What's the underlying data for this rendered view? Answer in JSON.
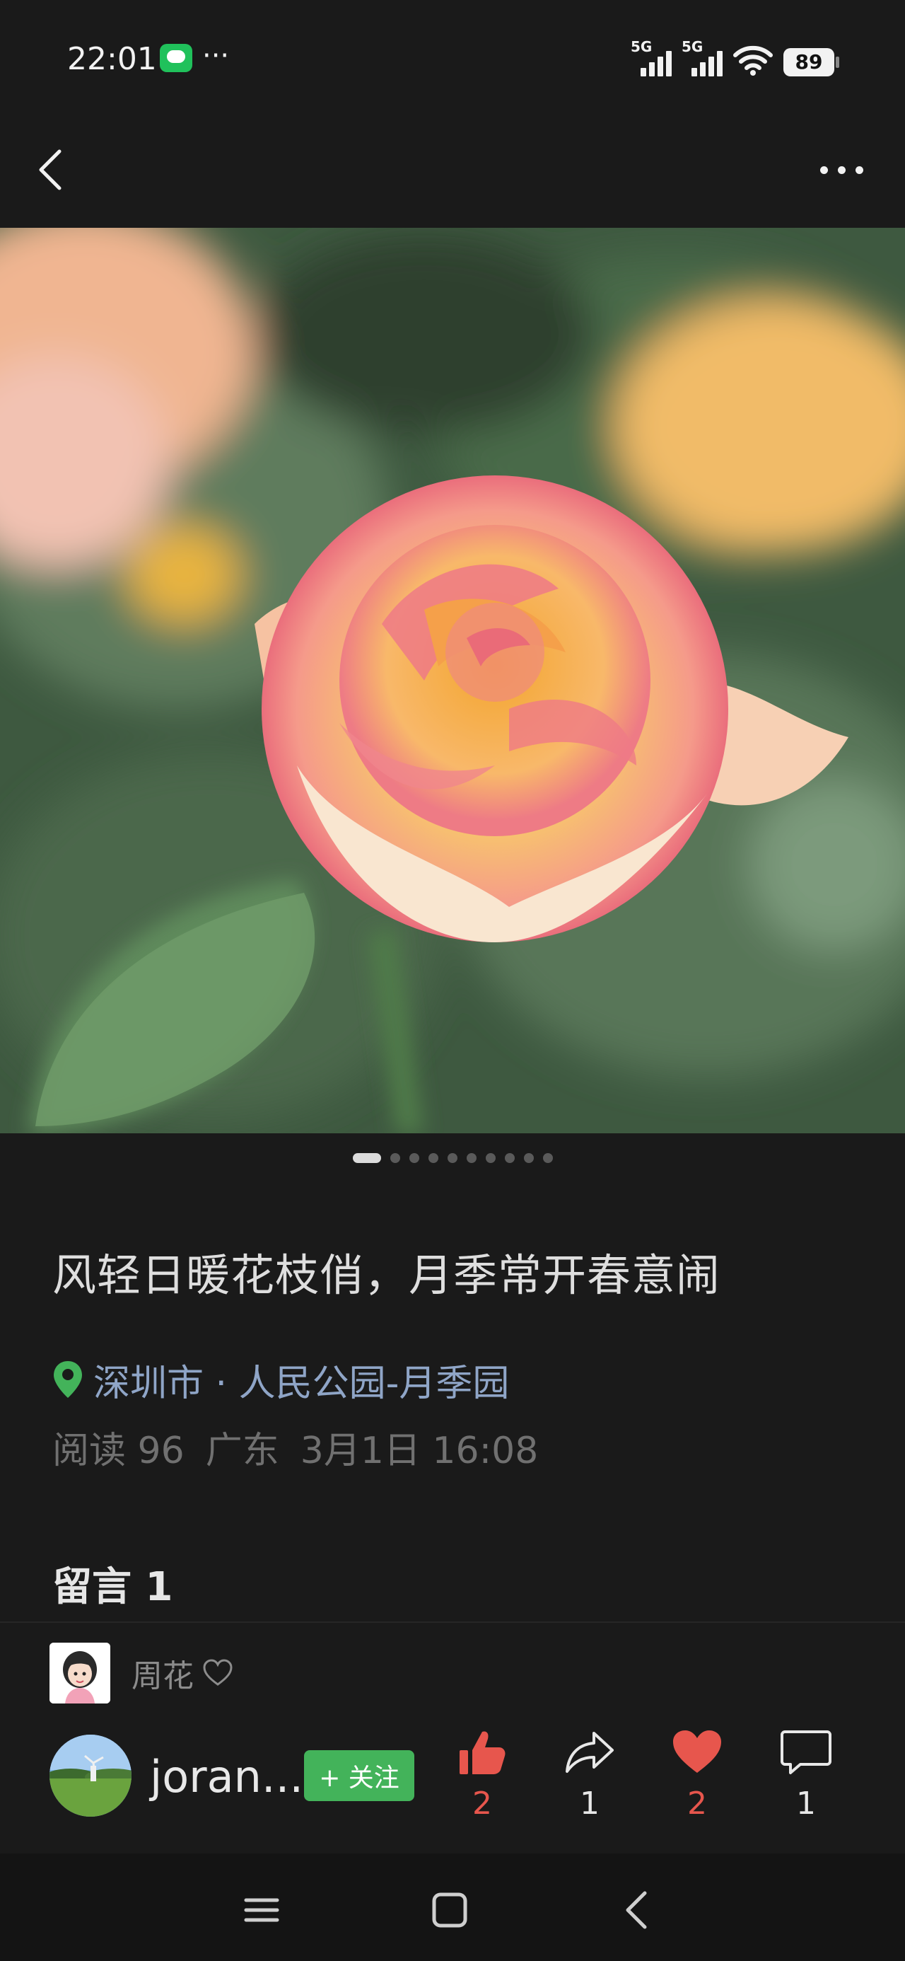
{
  "status_bar": {
    "time": "22:01",
    "more": "···",
    "signal_1_label": "5G",
    "signal_2_label": "5G",
    "battery": "89",
    "icons": [
      "message-icon",
      "signal-icon",
      "wifi-icon",
      "battery-icon"
    ]
  },
  "nav": {
    "back_icon": "chevron-left-icon",
    "more_icon": "more-horizontal-icon"
  },
  "gallery": {
    "photo_count": 10,
    "active_index": 0
  },
  "post": {
    "title": "风轻日暖花枝俏，月季常开春意闹",
    "location": "深圳市 · 人民公园-月季园",
    "read_label": "阅读",
    "read_count": "96",
    "region": "广东",
    "datetime": "3月1日 16:08"
  },
  "comments": {
    "heading": "留言 1",
    "items": [
      {
        "name": "周花",
        "icon": "heart-outline-icon"
      }
    ]
  },
  "author": {
    "name": "joran...",
    "follow_label": "+ 关注"
  },
  "actions": {
    "like": {
      "count": "2",
      "icon": "thumbs-up-icon"
    },
    "share": {
      "count": "1",
      "icon": "share-icon"
    },
    "favorite": {
      "count": "2",
      "icon": "heart-icon"
    },
    "comment": {
      "count": "1",
      "icon": "comment-icon"
    }
  },
  "colors": {
    "background": "#1a1a1a",
    "accent_green": "#43b35a",
    "active_red": "#e7564d",
    "location_blue": "#8fa5c7"
  },
  "system_nav": {
    "icons": [
      "menu-icon",
      "home-icon",
      "back-icon"
    ]
  }
}
